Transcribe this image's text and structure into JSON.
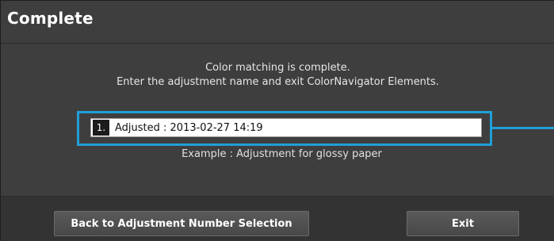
{
  "dialog": {
    "title": "Complete",
    "message_line1": "Color matching is complete.",
    "message_line2": "Enter the adjustment name and exit ColorNavigator Elements."
  },
  "name_field": {
    "index_label": "1.",
    "value": "Adjusted : 2013-02-27 14:19",
    "example": "Example : Adjustment for glossy paper"
  },
  "buttons": {
    "back_label": "Back to Adjustment Number Selection",
    "exit_label": "Exit"
  },
  "colors": {
    "highlight": "#1f9fd8",
    "background": "#3e3e3e"
  }
}
